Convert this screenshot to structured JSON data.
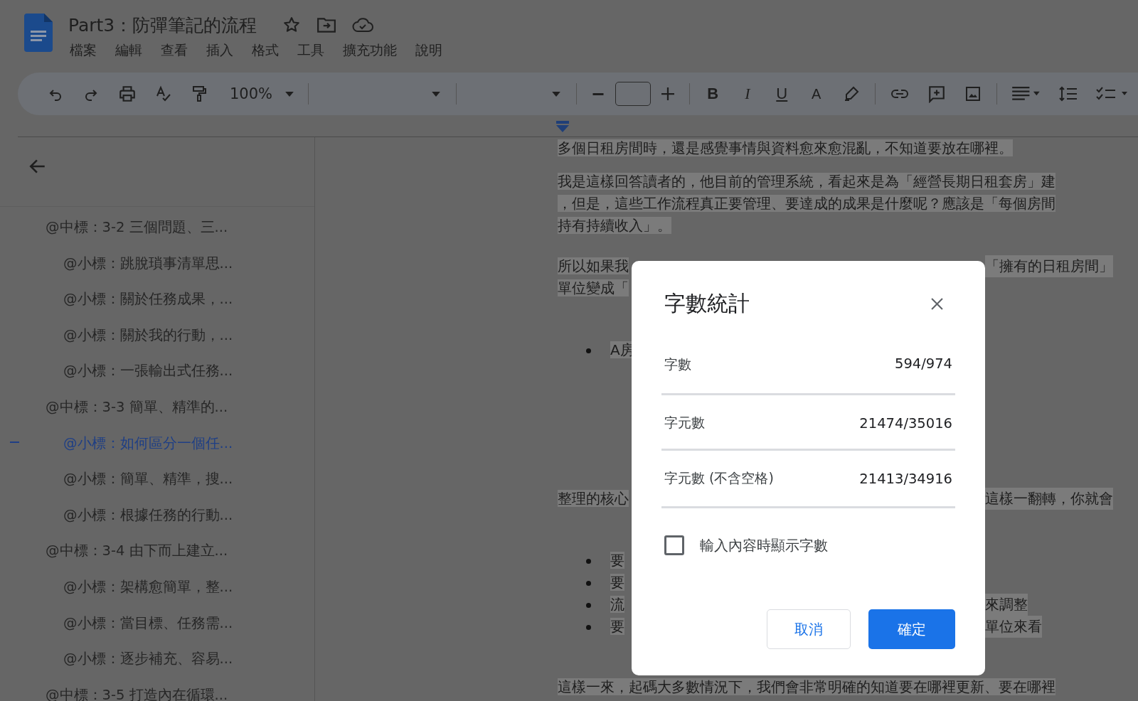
{
  "document": {
    "title": "Part3：防彈筆記的流程"
  },
  "menu": [
    "檔案",
    "編輯",
    "查看",
    "插入",
    "格式",
    "工具",
    "擴充功能",
    "說明"
  ],
  "toolbar": {
    "zoom": "100%",
    "format_buttons": [
      {
        "label": "B",
        "kind": "bold"
      },
      {
        "label": "I",
        "kind": "italic"
      },
      {
        "label": "U",
        "kind": "underline"
      },
      {
        "label": "A",
        "kind": "color"
      }
    ]
  },
  "outline": [
    {
      "text": "@中標：3-2 三個問題、三...",
      "selected": false,
      "children": [
        {
          "text": "@小標：跳脫瑣事清單思...",
          "selected": false
        },
        {
          "text": "@小標：關於任務成果，...",
          "selected": false
        },
        {
          "text": "@小標：關於我的行動，...",
          "selected": false
        },
        {
          "text": "@小標：一張輸出式任務...",
          "selected": false
        }
      ]
    },
    {
      "text": "@中標：3-3 簡單、精準的...",
      "selected": false,
      "children": [
        {
          "text": "@小標：如何區分一個任...",
          "selected": true
        },
        {
          "text": "@小標：簡單、精準，搜...",
          "selected": false
        },
        {
          "text": "@小標：根據任務的行動...",
          "selected": false
        }
      ]
    },
    {
      "text": "@中標：3-4 由下而上建立...",
      "selected": false,
      "children": [
        {
          "text": "@小標：架構愈簡單，整...",
          "selected": false
        },
        {
          "text": "@小標：當目標、任務需...",
          "selected": false
        },
        {
          "text": "@小標：逐步補充、容易...",
          "selected": false
        }
      ]
    },
    {
      "text": "@中標：3-5 打造內在循環...",
      "selected": false
    }
  ],
  "body": [
    {
      "kind": "paragraph",
      "lines": [
        {
          "text": "多個日租房間時，還是感覺事情與資料愈來愈混亂，不知道要放在哪裡。"
        }
      ]
    },
    {
      "kind": "paragraph",
      "lines": [
        {
          "text": "我是這樣回答讀者的，他目前的管理系統，看起來是為「經營長期日租套房」建"
        },
        {
          "text": "，但是，這些工作流程真正要管理、要達成的成果是什麼呢？應該是「每個房間"
        },
        {
          "text": "持有持續收入」。"
        }
      ]
    },
    {
      "kind": "paragraph",
      "lines": [
        {
          "text": "所以如果我",
          "right": "「擁有的日租房間」"
        },
        {
          "text": "單位變成「"
        }
      ]
    },
    {
      "kind": "bullets",
      "lines": [
        {
          "text": "A房"
        }
      ]
    },
    {
      "kind": "paragraph",
      "lines": [
        {
          "text": "整理的核心",
          "right": "這樣一翻轉，你就會"
        }
      ]
    },
    {
      "kind": "bullets",
      "lines": [
        {
          "text": "要"
        },
        {
          "text": "要"
        },
        {
          "text": "流",
          "right": "來調整"
        },
        {
          "text": "要",
          "right": "單位來看"
        }
      ]
    },
    {
      "kind": "paragraph",
      "lines": [
        {
          "text": "這樣一來，起碼大多數情況下，我們會非常明確的知道要在哪裡更新、要在哪裡"
        }
      ]
    }
  ],
  "dialog": {
    "title": "字數統計",
    "stats": [
      {
        "label": "字數",
        "value": "594/974"
      },
      {
        "label": "字元數",
        "value": "21474/35016"
      },
      {
        "label": "字元數 (不含空格)",
        "value": "21413/34916"
      }
    ],
    "show_while_typing": {
      "label": "輸入內容時顯示字數",
      "checked": false
    },
    "buttons": [
      {
        "label": "取消",
        "kind": "secondary"
      },
      {
        "label": "確定",
        "kind": "primary"
      }
    ]
  }
}
